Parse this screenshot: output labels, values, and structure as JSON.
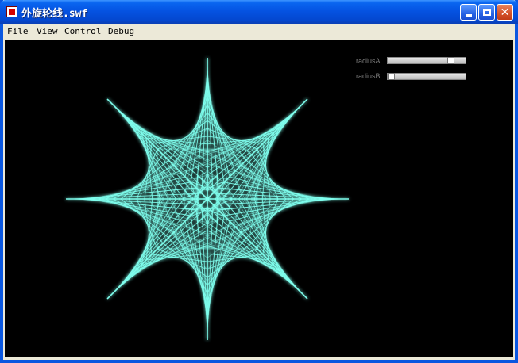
{
  "window": {
    "title": "外旋轮线.swf",
    "controls": [
      "minimize",
      "maximize",
      "close"
    ]
  },
  "menu": {
    "items": [
      "File",
      "View",
      "Control",
      "Debug"
    ]
  },
  "stage": {
    "background": "#000000",
    "line_color": "#7fffee",
    "glow_color": "#40e0d0",
    "lobes": 8
  },
  "sliders": [
    {
      "label": "radiusA",
      "value": 0.84
    },
    {
      "label": "radiusB",
      "value": 0.0
    }
  ]
}
